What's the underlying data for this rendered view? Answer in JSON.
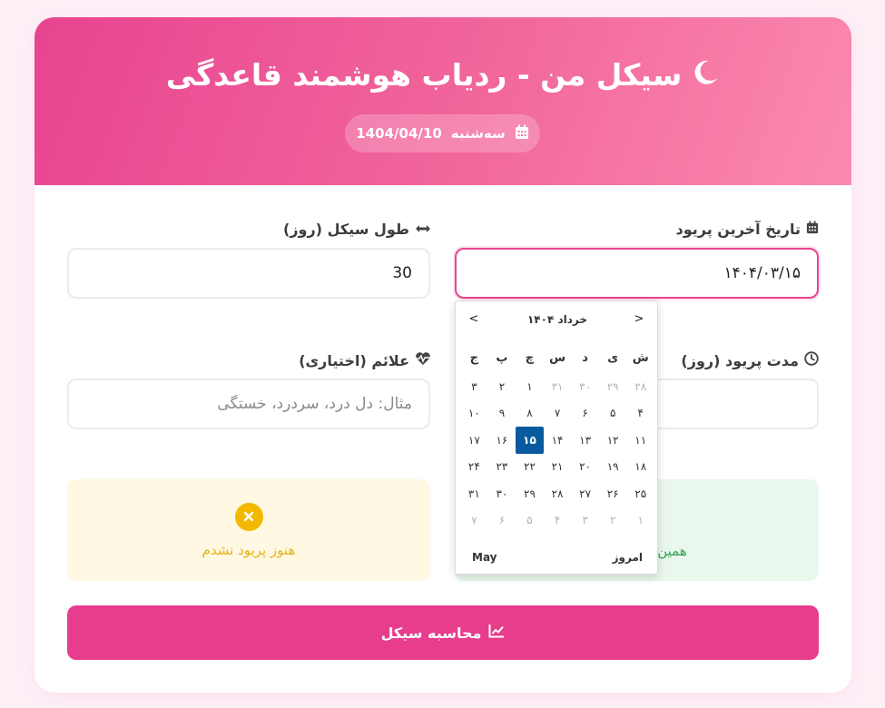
{
  "header": {
    "title": "سیکل من - ردیاب هوشمند قاعدگی",
    "date_weekday": "سه‌شنبه",
    "date_value": "1404/04/10"
  },
  "fields": {
    "last_period": {
      "label": "تاریخ آخرین پریود",
      "value": "۱۴۰۴/۰۳/۱۵"
    },
    "cycle_length": {
      "label": "طول سیکل (روز)",
      "value": "30"
    },
    "period_duration": {
      "label": "مدت پریود (روز)"
    },
    "symptoms": {
      "label": "علائم (اختیاری)",
      "placeholder": "مثال: دل درد، سردرد، خستگی"
    }
  },
  "status_cards": {
    "not_started": {
      "text": "هنوز پریود نشدم"
    },
    "started": {
      "text": "همین ام"
    }
  },
  "calculate_button": {
    "label": "محاسبه سیکل"
  },
  "datepicker": {
    "prev": "<",
    "next": ">",
    "month_title": "خرداد ۱۴۰۴",
    "weekdays": [
      "ش",
      "ی",
      "د",
      "س",
      "چ",
      "پ",
      "ج"
    ],
    "weeks": [
      [
        {
          "d": "۲۸",
          "m": true
        },
        {
          "d": "۲۹",
          "m": true
        },
        {
          "d": "۳۰",
          "m": true
        },
        {
          "d": "۳۱",
          "m": true
        },
        {
          "d": "۱"
        },
        {
          "d": "۲"
        },
        {
          "d": "۳"
        }
      ],
      [
        {
          "d": "۴"
        },
        {
          "d": "۵"
        },
        {
          "d": "۶"
        },
        {
          "d": "۷"
        },
        {
          "d": "۸"
        },
        {
          "d": "۹"
        },
        {
          "d": "۱۰"
        }
      ],
      [
        {
          "d": "۱۱"
        },
        {
          "d": "۱۲"
        },
        {
          "d": "۱۳"
        },
        {
          "d": "۱۴"
        },
        {
          "d": "۱۵",
          "s": true
        },
        {
          "d": "۱۶"
        },
        {
          "d": "۱۷"
        }
      ],
      [
        {
          "d": "۱۸"
        },
        {
          "d": "۱۹"
        },
        {
          "d": "۲۰"
        },
        {
          "d": "۲۱"
        },
        {
          "d": "۲۲"
        },
        {
          "d": "۲۳"
        },
        {
          "d": "۲۴"
        }
      ],
      [
        {
          "d": "۲۵"
        },
        {
          "d": "۲۶"
        },
        {
          "d": "۲۷"
        },
        {
          "d": "۲۸"
        },
        {
          "d": "۲۹"
        },
        {
          "d": "۳۰"
        },
        {
          "d": "۳۱"
        }
      ],
      [
        {
          "d": "۱",
          "m": true
        },
        {
          "d": "۲",
          "m": true
        },
        {
          "d": "۳",
          "m": true
        },
        {
          "d": "۴",
          "m": true
        },
        {
          "d": "۵",
          "m": true
        },
        {
          "d": "۶",
          "m": true
        },
        {
          "d": "۷",
          "m": true
        }
      ]
    ],
    "today_label": "امروز",
    "month_toggle_label": "May"
  },
  "colors": {
    "brand_pink": "#e84490",
    "selected_day": "#0a5aa0",
    "warning": "#f3b800",
    "success": "#35a552"
  }
}
